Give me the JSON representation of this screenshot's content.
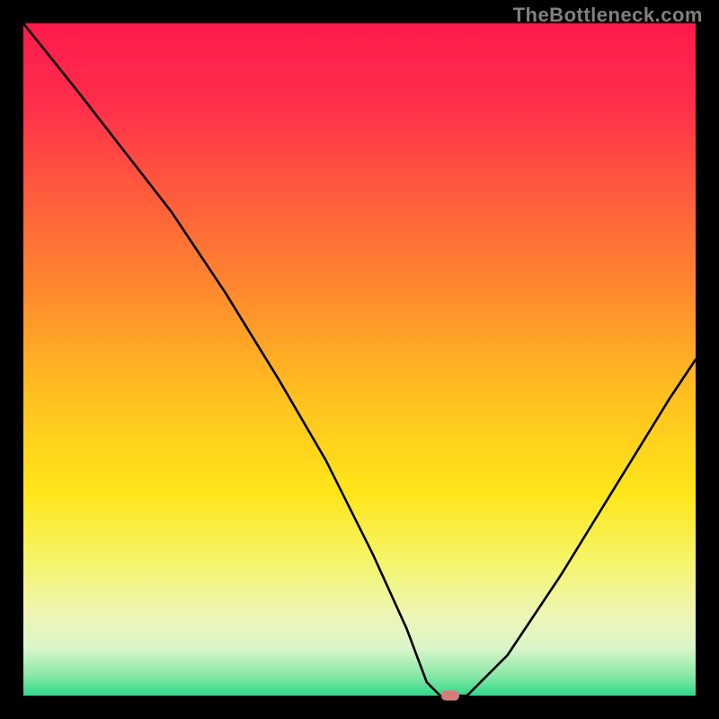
{
  "watermark": "TheBottleneck.com",
  "chart_data": {
    "type": "line",
    "title": "",
    "xlabel": "",
    "ylabel": "",
    "xlim": [
      0,
      100
    ],
    "ylim": [
      0,
      100
    ],
    "series": [
      {
        "name": "bottleneck-curve",
        "x": [
          0,
          8,
          15,
          22,
          30,
          38,
          45,
          52,
          57,
          60,
          62,
          66,
          72,
          80,
          88,
          96,
          100
        ],
        "values": [
          100,
          90,
          81,
          72,
          60,
          47,
          35,
          21,
          10,
          2,
          0,
          0,
          6,
          18,
          31,
          44,
          50
        ]
      }
    ],
    "optimal_marker": {
      "x": 63.5,
      "y": 0
    },
    "gradient_stops": [
      {
        "offset": 0,
        "color": "#ff1a4d"
      },
      {
        "offset": 0.12,
        "color": "#ff2e4a"
      },
      {
        "offset": 0.25,
        "color": "#ff5a3d"
      },
      {
        "offset": 0.4,
        "color": "#ff8a2e"
      },
      {
        "offset": 0.55,
        "color": "#ffbf1f"
      },
      {
        "offset": 0.7,
        "color": "#ffe61a"
      },
      {
        "offset": 0.8,
        "color": "#f5f56a"
      },
      {
        "offset": 0.88,
        "color": "#eef5b5"
      },
      {
        "offset": 0.93,
        "color": "#d9f5c8"
      },
      {
        "offset": 0.97,
        "color": "#8ae8a8"
      },
      {
        "offset": 1.0,
        "color": "#2ed98a"
      }
    ]
  }
}
